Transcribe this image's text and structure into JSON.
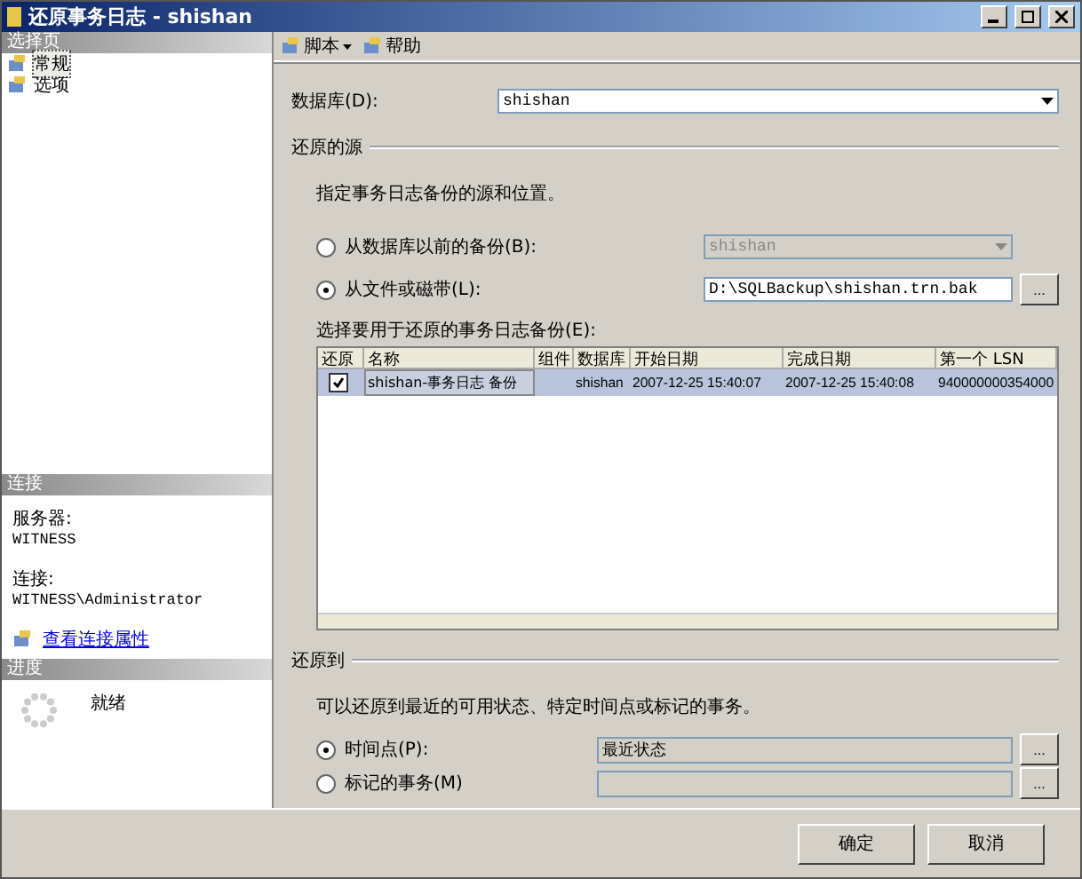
{
  "window": {
    "title": "还原事务日志 - shishan"
  },
  "sidebar": {
    "header": "选择页",
    "items": [
      {
        "label": "常规",
        "selected": true
      },
      {
        "label": "选项",
        "selected": false
      }
    ]
  },
  "connection": {
    "header": "连接",
    "server_label": "服务器:",
    "server": "WITNESS",
    "conn_label": "连接:",
    "conn": "WITNESS\\Administrator",
    "link": "查看连接属性"
  },
  "progress": {
    "header": "进度",
    "status": "就绪"
  },
  "toolbar": [
    {
      "label": "脚本",
      "kind": "menu"
    },
    {
      "label": "帮助",
      "kind": "button"
    }
  ],
  "database": {
    "label": "数据库(D):",
    "value": "shishan"
  },
  "source": {
    "title": "还原的源",
    "hint": "指定事务日志备份的源和位置。",
    "options": [
      {
        "label": "从数据库以前的备份(B):",
        "selected": false,
        "kind": "dropdown",
        "disabled": true,
        "value": "shishan"
      },
      {
        "label": "从文件或磁带(L):",
        "selected": true,
        "kind": "browse",
        "disabled": false,
        "value": "D:\\SQLBackup\\shishan.trn.bak",
        "button": "..."
      }
    ],
    "table_label": "选择要用于还原的事务日志备份(E):",
    "columns": [
      "还原",
      "名称",
      "组件",
      "数据库",
      "开始日期",
      "完成日期",
      "第一个 LSN"
    ],
    "rows": [
      {
        "checked": true,
        "selected": true,
        "cells": [
          "",
          "shishan-事务日志 备份",
          "",
          "shishan",
          "2007-12-25 15:40:07",
          "2007-12-25 15:40:08",
          "940000000354000"
        ]
      }
    ]
  },
  "restore_to": {
    "title": "还原到",
    "hint": "可以还原到最近的可用状态、特定时间点或标记的事务。",
    "options": [
      {
        "label": "时间点(P):",
        "selected": true,
        "value": "最近状态",
        "button": "..."
      },
      {
        "label": "标记的事务(M)",
        "selected": false,
        "button": "..."
      }
    ]
  },
  "buttons": [
    "确定",
    "取消"
  ]
}
